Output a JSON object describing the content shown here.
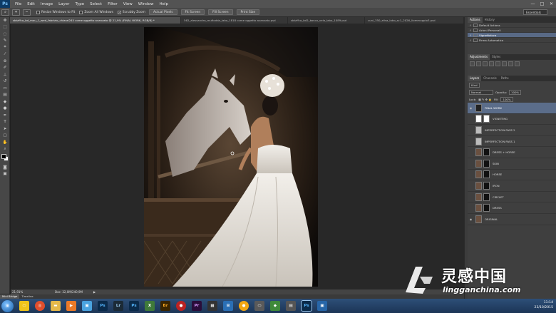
{
  "app": {
    "logo": "Ps"
  },
  "menu": [
    "File",
    "Edit",
    "Image",
    "Layer",
    "Type",
    "Select",
    "Filter",
    "View",
    "Window",
    "Help"
  ],
  "window_controls": [
    "—",
    "□",
    "✕"
  ],
  "options_bar": {
    "checks": [
      "Resize Windows to Fit",
      "Zoom All Windows",
      "Scrubby Zoom"
    ],
    "buttons": [
      "Actual Pixels",
      "Fit Screen",
      "Fill Screen",
      "Print Size"
    ],
    "workspace": "Essentials"
  },
  "doc_tabs": [
    "sbtzffca_bd_mou_1_wed_fabrizio_chiarai245 come oggetto avanzato @ 21,9% (FINAL WORK, RGB/8) *",
    "562_alessandra_mufiodda_labo_1818 come oggetto avanzato.psd",
    "sbtzffca_bd2_bosco_vela_labo_1089.psd",
    "cuni_350_elisa_labo_sc1_2026_liommoppio3.psd"
  ],
  "status": {
    "zoom": "21,91%",
    "doc": "Doc: 32,0M/240,9M"
  },
  "bottom_tabs": [
    "Mini Bridge",
    "Timeline"
  ],
  "actions_panel": {
    "tabs": [
      "Actions",
      "History"
    ],
    "rows": [
      {
        "label": "Default Actions",
        "selected": false
      },
      {
        "label": "Azioni Personali",
        "selected": false
      },
      {
        "label": "Vignettatura",
        "selected": true
      },
      {
        "label": "Firma Automatica",
        "selected": false
      }
    ]
  },
  "adjustments_panel": {
    "tabs": [
      "Adjustments",
      "Styles"
    ]
  },
  "layers_panel": {
    "tabs": [
      "Layers",
      "Channels",
      "Paths"
    ],
    "kind": "Kind",
    "blend": "Normal",
    "opacity_label": "Opacity:",
    "opacity": "100%",
    "lock_label": "Lock:",
    "fill_label": "Fill:",
    "fill": "100%",
    "layers": [
      {
        "name": "FINAL WORK",
        "selected": true,
        "mask": false
      },
      {
        "name": "VIGNETING",
        "selected": false,
        "mask": true
      },
      {
        "name": "IMPERFECTION PASS 2",
        "selected": false,
        "mask": false
      },
      {
        "name": "IMPERFECTION PASS 1",
        "selected": false,
        "mask": false
      },
      {
        "name": "DRESS + HORSE",
        "selected": false,
        "mask": true
      },
      {
        "name": "SKIN",
        "selected": false,
        "mask": true
      },
      {
        "name": "HORSE",
        "selected": false,
        "mask": true
      },
      {
        "name": "IRON",
        "selected": false,
        "mask": true
      },
      {
        "name": "CIRCLET",
        "selected": false,
        "mask": true
      },
      {
        "name": "DRESS",
        "selected": false,
        "mask": true
      },
      {
        "name": "ORIGINAL",
        "selected": false,
        "mask": false
      }
    ]
  },
  "taskbar": {
    "apps": [
      "Ps",
      "Lr",
      "Ps",
      "Br",
      "Pr"
    ],
    "time": "11:14",
    "date": "23/10/2015"
  },
  "watermark": {
    "chinese": "灵感中国",
    "url": "lingganchina.com"
  }
}
